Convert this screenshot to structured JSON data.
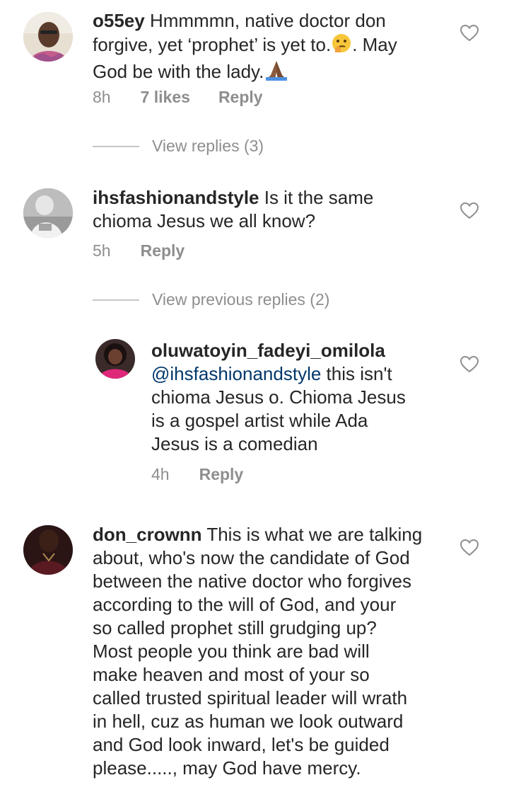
{
  "comments": [
    {
      "username": "o55ey",
      "text_a": "Hmmmmn, native doctor don",
      "text_b": "forgive, yet ‘prophet’ is yet to.",
      "text_c": ". May",
      "text_d": "God be with the lady.",
      "time": "8h",
      "likes": "7 likes",
      "reply": "Reply",
      "view_replies": "View replies (3)"
    },
    {
      "username": "ihsfashionandstyle",
      "text_a": "Is it the same",
      "text_b": "chioma Jesus we all know?",
      "time": "5h",
      "reply": "Reply",
      "view_replies": "View previous replies (2)"
    },
    {
      "username": "oluwatoyin_fadeyi_omilola",
      "mention": "@ihsfashionandstyle",
      "text_a": "this isn't",
      "text_b": "chioma Jesus o. Chioma Jesus",
      "text_c": "is a gospel artist while Ada",
      "text_d": "Jesus is a comedian",
      "time": "4h",
      "reply": "Reply"
    },
    {
      "username": "don_crownn",
      "text_a": "This is what we are talking",
      "text_b": "about, who's now the candidate of God",
      "text_c": "between the native doctor who forgives",
      "text_d": "according to the will of God, and your",
      "text_e": "so called prophet still grudging up?",
      "text_f": "Most people you think are bad will",
      "text_g": "make heaven and most of your so",
      "text_h": "called trusted spiritual leader will wrath",
      "text_i": "in hell, cuz as human we look outward",
      "text_j": "and God look inward, let's be guided",
      "text_k": "please....., may God have mercy."
    }
  ],
  "icons": {
    "heart": "heart-outline-icon",
    "thinking": "thinking-face-emoji",
    "pray": "folded-hands-emoji"
  }
}
